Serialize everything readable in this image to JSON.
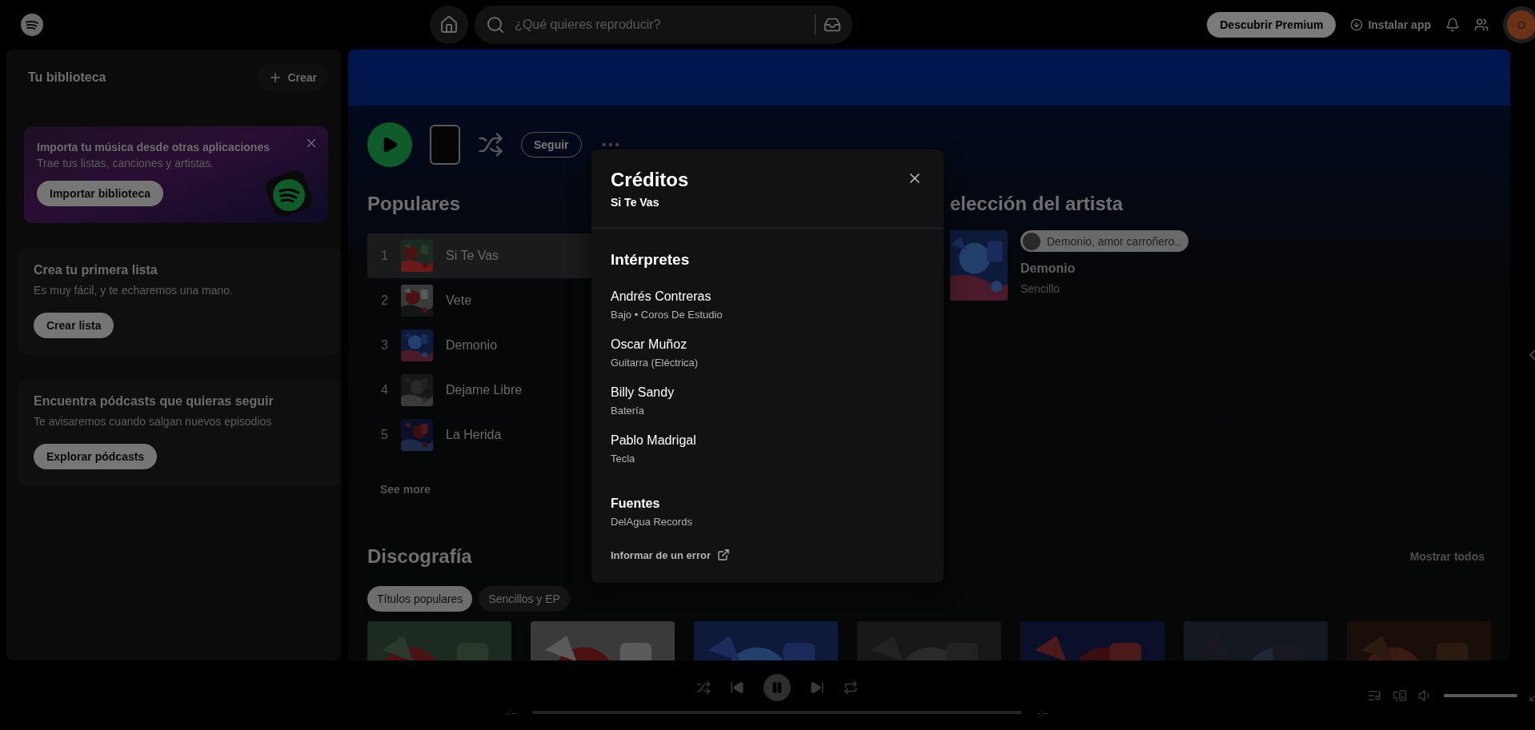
{
  "top_bar": {
    "search": {
      "placeholder": "¿Qué quieres reproducir?"
    },
    "premium_button": "Descubrir Premium",
    "install_link": "Instalar app",
    "avatar": "O"
  },
  "library": {
    "title": "Tu biblioteca",
    "create_button": "Crear",
    "import_card": {
      "title": "Importa tu música desde otras aplicaciones",
      "text": "Trae tus listas, canciones y artistas.",
      "button": "Importar biblioteca"
    },
    "cards": [
      {
        "title": "Crea tu primera lista",
        "text": "Es muy fácil, y te echaremos una mano.",
        "button": "Crear lista"
      },
      {
        "title": "Encuentra pódcasts que quieras seguir",
        "text": "Te avisaremos cuando salgan nuevos episodios",
        "button": "Explorar pódcasts"
      }
    ]
  },
  "artist": {
    "follow_button": "Seguir",
    "popular": {
      "title": "Populares",
      "see_more": "See more",
      "tracks": [
        {
          "number": "1",
          "title": "Si Te Vas",
          "selected": true
        },
        {
          "number": "2",
          "title": "Vete",
          "selected": false
        },
        {
          "number": "3",
          "title": "Demonio",
          "selected": false
        },
        {
          "number": "4",
          "title": "Dejame Libre",
          "selected": false
        },
        {
          "number": "5",
          "title": "La Herida",
          "selected": false
        }
      ]
    },
    "artist_pick": {
      "title": "elección del artista",
      "pill": "Demonio, amor carroñero..",
      "name": "Demonio",
      "type": "Sencillo"
    },
    "discography": {
      "title": "Discografía",
      "show_all": "Mostrar todos",
      "filters": [
        {
          "label": "Títulos populares",
          "selected": true
        },
        {
          "label": "Sencillos y EP",
          "selected": false
        }
      ]
    }
  },
  "credits_dialog": {
    "title": "Créditos",
    "subtitle": "Si Te Vas",
    "performers_title": "Intérpretes",
    "performers": [
      {
        "name": "Andrés Contreras",
        "roles": "Bajo • Coros De Estudio"
      },
      {
        "name": "Oscar Muñoz",
        "roles": "Guitarra (Eléctrica)"
      },
      {
        "name": "Billy Sandy",
        "roles": "Batería"
      },
      {
        "name": "Pablo Madrigal",
        "roles": "Tecla"
      }
    ],
    "sources_title": "Fuentes",
    "source": "DelAgua Records",
    "report_link": "Informar de un error"
  },
  "player": {
    "elapsed": "-:--",
    "remaining": "-:--",
    "progress": {
      "level": 0
    },
    "volume": {
      "level": 1
    }
  }
}
